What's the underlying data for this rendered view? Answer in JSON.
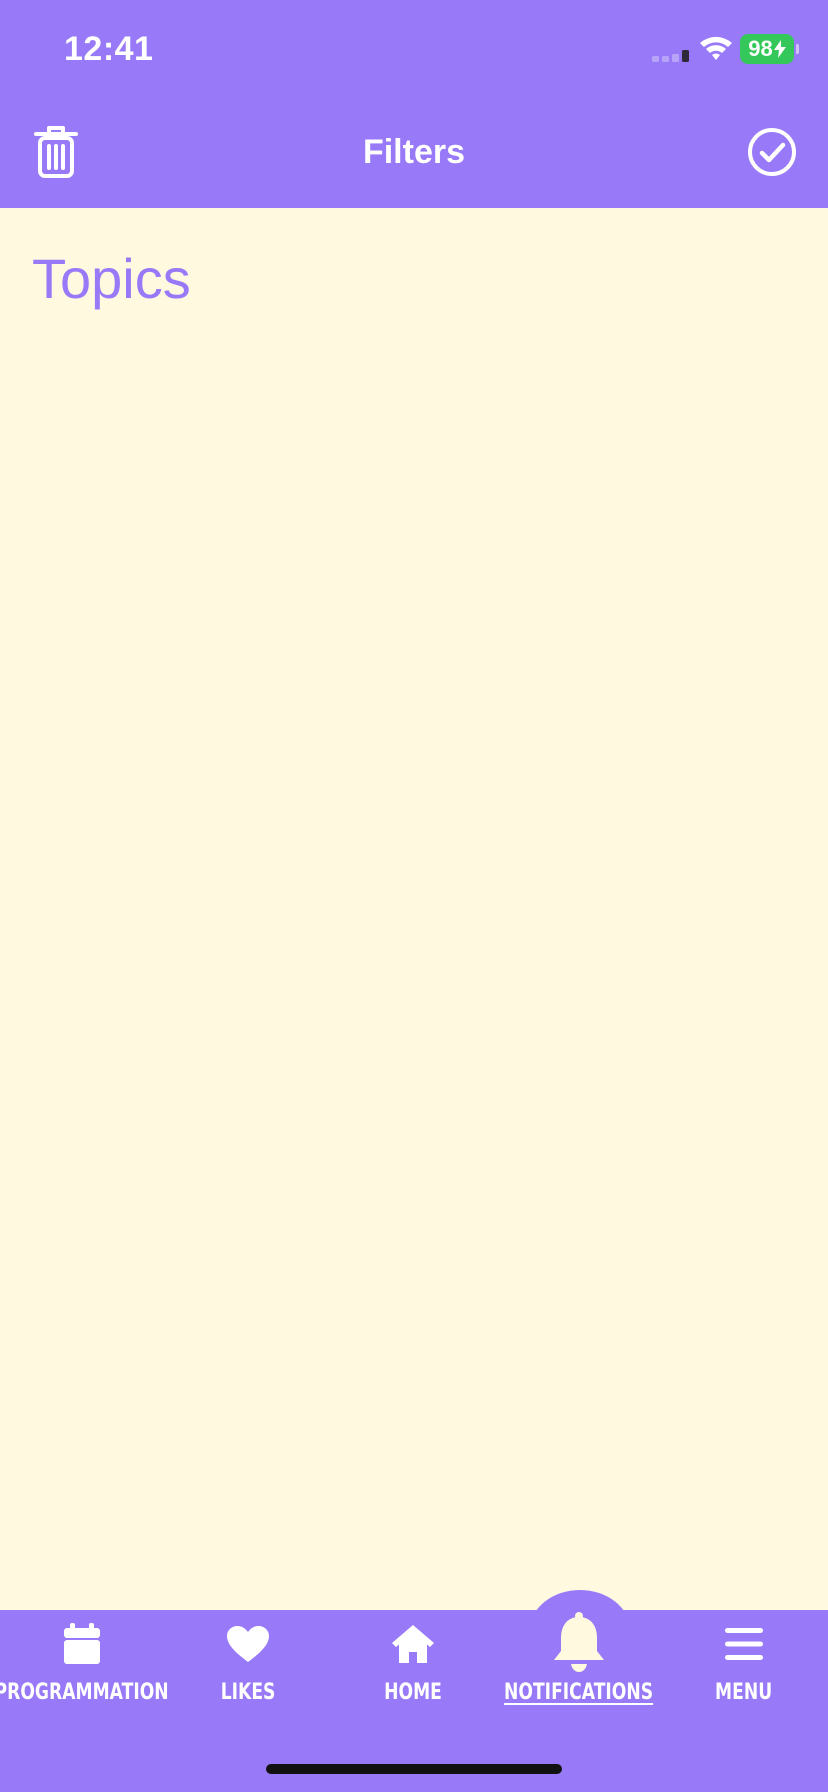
{
  "status_bar": {
    "time": "12:41",
    "battery": "98"
  },
  "header": {
    "title": "Filters",
    "left_icon": "trash-icon",
    "right_icon": "check-circle-icon"
  },
  "content": {
    "section_title": "Topics"
  },
  "tab_bar": {
    "active": "notifications",
    "items": [
      {
        "id": "programmation",
        "label": "PROGRAMMATION",
        "icon": "calendar-icon"
      },
      {
        "id": "likes",
        "label": "LIKES",
        "icon": "heart-icon"
      },
      {
        "id": "home",
        "label": "HOME",
        "icon": "home-icon"
      },
      {
        "id": "notifications",
        "label": "NOTIFICATIONS",
        "icon": "bell-icon"
      },
      {
        "id": "menu",
        "label": "MENU",
        "icon": "hamburger-menu-icon"
      }
    ]
  },
  "colors": {
    "primary": "#9879F7",
    "background": "#FFF9DF",
    "battery": "#34C759",
    "white": "#FFFFFF"
  }
}
